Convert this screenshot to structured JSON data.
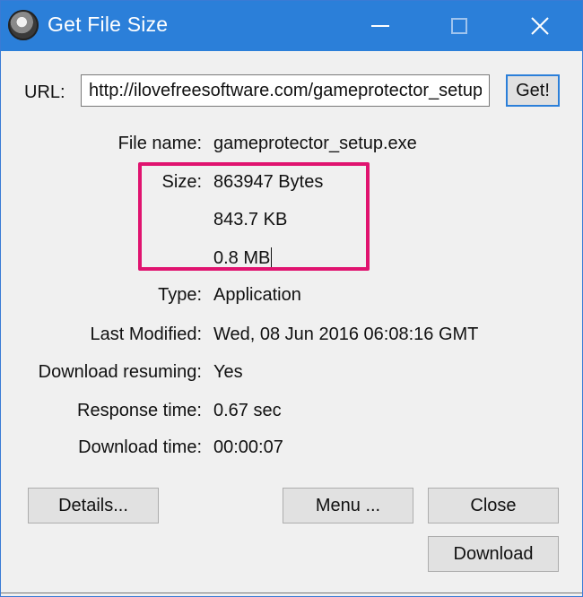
{
  "window": {
    "title": "Get File Size",
    "minimize_icon": "minimize-icon",
    "maximize_icon": "maximize-icon",
    "close_icon": "close-icon",
    "title_bar_color": "#2b7fd9"
  },
  "url": {
    "label": "URL:",
    "value": "http://ilovefreesoftware.com/gameprotector_setup.exe",
    "get_button": "Get!"
  },
  "fields": {
    "file_name": {
      "label": "File name:",
      "value": "gameprotector_setup.exe"
    },
    "size": {
      "label": "Size:",
      "bytes": "863947 Bytes",
      "kb": "843.7 KB",
      "mb": "0.8 MB"
    },
    "type": {
      "label": "Type:",
      "value": "Application"
    },
    "last_modified": {
      "label": "Last Modified:",
      "value": "Wed, 08 Jun 2016 06:08:16 GMT"
    },
    "download_resuming": {
      "label": "Download resuming:",
      "value": "Yes"
    },
    "response_time": {
      "label": "Response time:",
      "value": "0.67 sec"
    },
    "download_time": {
      "label": "Download time:",
      "value": "00:00:07"
    }
  },
  "buttons": {
    "details": "Details...",
    "menu": "Menu ...",
    "close": "Close",
    "download": "Download"
  },
  "highlight_color": "#e0136f"
}
